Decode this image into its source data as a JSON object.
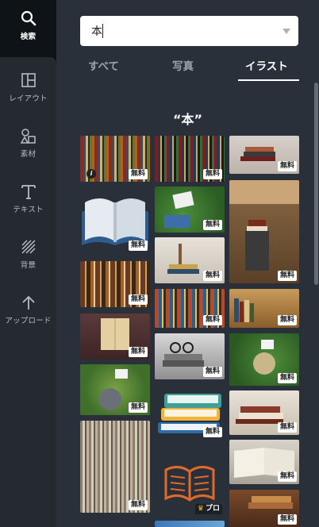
{
  "rail": {
    "items": [
      {
        "label": "検索",
        "icon": "search-icon",
        "active": true
      },
      {
        "label": "レイアウト",
        "icon": "layout-icon"
      },
      {
        "label": "素材",
        "icon": "elements-icon"
      },
      {
        "label": "テキスト",
        "icon": "text-icon"
      },
      {
        "label": "背景",
        "icon": "background-icon"
      },
      {
        "label": "アップロード",
        "icon": "upload-icon"
      }
    ]
  },
  "search": {
    "value": "本",
    "placeholder": ""
  },
  "tabs": [
    {
      "label": "すべて"
    },
    {
      "label": "写真"
    },
    {
      "label": "イラスト",
      "active": true
    }
  ],
  "results": {
    "heading": "“本”",
    "badges": {
      "free": "無料",
      "pro": "プロ"
    },
    "info_glyph": "i"
  },
  "colors": {
    "rail": "#0e1318",
    "panel": "#293039",
    "accent": "#ffffff",
    "crown": "#f5b623"
  }
}
